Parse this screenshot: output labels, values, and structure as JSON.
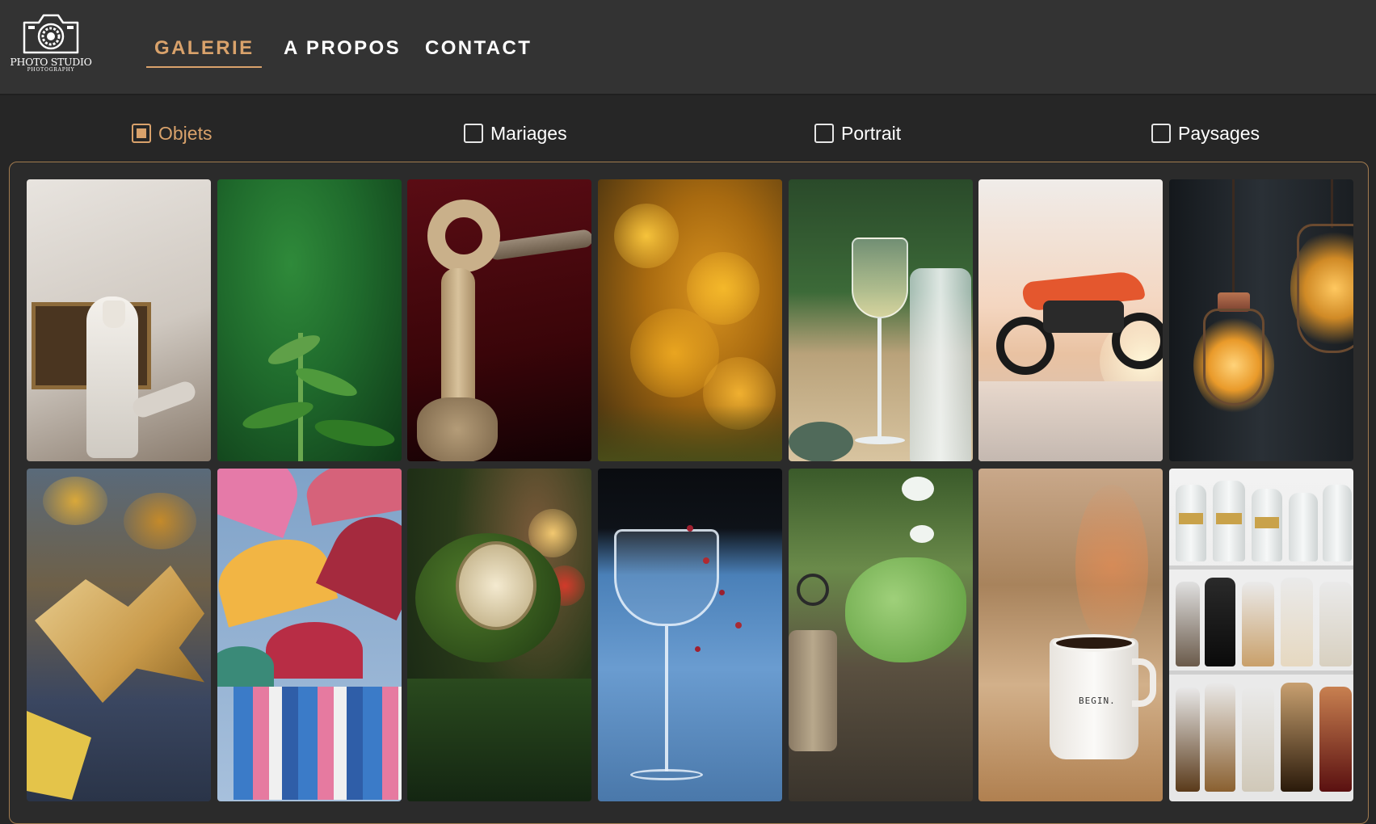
{
  "logo": {
    "name": "PHOTO STUDIO",
    "tagline": "PHOTOGRAPHY",
    "icon": "camera-icon"
  },
  "nav": {
    "items": [
      {
        "label": "GALERIE",
        "active": true
      },
      {
        "label": "A PROPOS",
        "active": false
      },
      {
        "label": "CONTACT",
        "active": false
      }
    ]
  },
  "filters": [
    {
      "label": "Objets",
      "checked": true
    },
    {
      "label": "Mariages",
      "checked": false
    },
    {
      "label": "Portrait",
      "checked": false
    },
    {
      "label": "Paysages",
      "checked": false
    }
  ],
  "gallery": {
    "photos": [
      {
        "subject": "statue-photo"
      },
      {
        "subject": "plant-photo"
      },
      {
        "subject": "rope-knot-photo"
      },
      {
        "subject": "yellow-flowers-photo"
      },
      {
        "subject": "wine-glass-bottle-photo"
      },
      {
        "subject": "motorcycle-sunset-photo"
      },
      {
        "subject": "hanging-bulbs-photo"
      },
      {
        "subject": "autumn-leaf-photo"
      },
      {
        "subject": "umbrellas-photo"
      },
      {
        "subject": "christmas-ornament-photo"
      },
      {
        "subject": "glass-berries-photo"
      },
      {
        "subject": "garden-scissors-photo"
      },
      {
        "subject": "coffee-mug-photo",
        "mug_text": "BEGIN."
      },
      {
        "subject": "apothecary-jars-photo"
      }
    ]
  },
  "colors": {
    "accent": "#d9a26b",
    "header_bg": "#333333",
    "page_bg": "#262626"
  }
}
